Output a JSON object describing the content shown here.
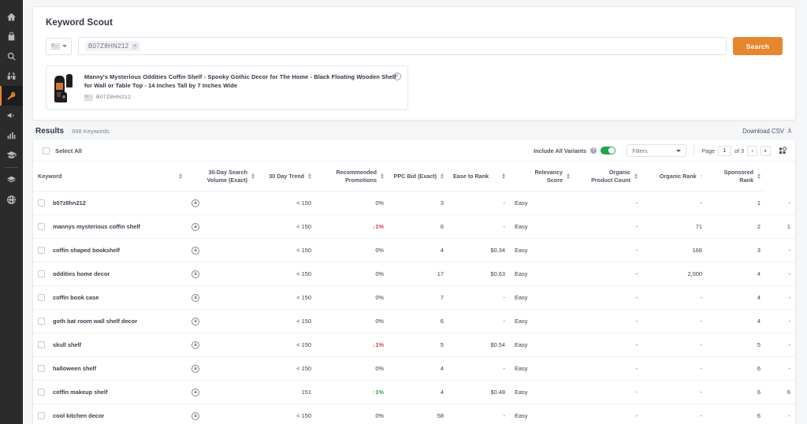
{
  "sidebar": {
    "items": [
      {
        "name": "home-icon",
        "label": "Home"
      },
      {
        "name": "product-database-icon",
        "label": "Product Database"
      },
      {
        "name": "search-icon",
        "label": "Opportunity Finder"
      },
      {
        "name": "binoculars-icon",
        "label": "Product Tracker"
      },
      {
        "name": "key-icon",
        "label": "Keyword Scout",
        "active": true
      },
      {
        "name": "megaphone-icon",
        "label": "Advertising"
      },
      {
        "name": "bar-chart-icon",
        "label": "Analytics"
      },
      {
        "name": "graduation-cap-icon",
        "label": "Academy"
      },
      {
        "name": "layers-icon",
        "label": "Tools"
      },
      {
        "name": "globe-icon",
        "label": "Global"
      }
    ]
  },
  "header": {
    "title": "Keyword Scout"
  },
  "search": {
    "country_flag": "us-flag-icon",
    "asin_chip": "B07Z8HN212",
    "chip_remove": "×",
    "search_button": "Search"
  },
  "product": {
    "title": "Manny's Mysterious Oddities Coffin Shelf - Spooky Gothic Decor for The Home - Black Floating Wooden Shelf for Wall or Table Top - 14 Inches Tall by 7 Inches Wide",
    "asin": "B07Z8HN212",
    "close": "×"
  },
  "results": {
    "label": "Results",
    "count": "698 Keywords",
    "download_csv": "Download CSV"
  },
  "toolbar": {
    "select_all": "Select All",
    "include_variants": "Include All Variants",
    "help": "?",
    "variants_on": true,
    "filters": "Filters",
    "page_label": "Page",
    "page_value": "1",
    "page_of": "of 3",
    "columns_icon": "columns-settings-icon"
  },
  "table": {
    "columns": [
      {
        "key": "keyword",
        "label": "Keyword",
        "align": "left",
        "sort": "arrows"
      },
      {
        "key": "volume",
        "label": "30-Day Search\nVolume (Exact)",
        "align": "right",
        "sort": "arrows"
      },
      {
        "key": "trend",
        "label": "30 Day Trend",
        "align": "right",
        "sort": "arrows"
      },
      {
        "key": "promos",
        "label": "Recommended\nPromotions",
        "align": "right",
        "sort": "arrows"
      },
      {
        "key": "ppc",
        "label": "PPC Bid (Exact)",
        "align": "right",
        "sort": "arrows"
      },
      {
        "key": "ease",
        "label": "Ease to Rank",
        "align": "left",
        "sort": "arrows"
      },
      {
        "key": "relevancy",
        "label": "Relevancy\nScore",
        "align": "right",
        "sort": "arrows"
      },
      {
        "key": "organic_count",
        "label": "Organic\nProduct Count",
        "align": "right",
        "sort": "arrows"
      },
      {
        "key": "organic_rank",
        "label": "Organic Rank",
        "align": "right",
        "sort": "dash"
      },
      {
        "key": "sponsored_rank",
        "label": "Sponsored\nRank",
        "align": "right",
        "sort": "arrows"
      }
    ],
    "rows": [
      {
        "keyword": "b07z8hn212",
        "source": "amazon-icon",
        "volume": "< 150",
        "trend": "0%",
        "trend_dir": "flat",
        "promos": "3",
        "ppc": "-",
        "ease": "Easy",
        "relevancy": "-",
        "organic_count": "-",
        "organic_rank": "1",
        "sponsored_rank": "-"
      },
      {
        "keyword": "mannys mysterious coffin shelf",
        "source": "amazon-icon",
        "volume": "< 150",
        "trend": "1%",
        "trend_dir": "down",
        "promos": "6",
        "ppc": "-",
        "ease": "Easy",
        "relevancy": "-",
        "organic_count": "71",
        "organic_rank": "2",
        "sponsored_rank": "1"
      },
      {
        "keyword": "coffin shaped bookshelf",
        "source": "amazon-icon",
        "volume": "< 150",
        "trend": "0%",
        "trend_dir": "flat",
        "promos": "4",
        "ppc": "$0.34",
        "ease": "Easy",
        "relevancy": "-",
        "organic_count": "168",
        "organic_rank": "3",
        "sponsored_rank": "-"
      },
      {
        "keyword": "oddities home decor",
        "source": "amazon-icon",
        "volume": "< 150",
        "trend": "0%",
        "trend_dir": "flat",
        "promos": "17",
        "ppc": "$0.63",
        "ease": "Easy",
        "relevancy": "-",
        "organic_count": "2,000",
        "organic_rank": "4",
        "sponsored_rank": "-"
      },
      {
        "keyword": "coffin book case",
        "source": "amazon-icon",
        "volume": "< 150",
        "trend": "0%",
        "trend_dir": "flat",
        "promos": "7",
        "ppc": "-",
        "ease": "Easy",
        "relevancy": "-",
        "organic_count": "-",
        "organic_rank": "4",
        "sponsored_rank": "-"
      },
      {
        "keyword": "goth bat room wall shelf decor",
        "source": "amazon-icon",
        "volume": "< 150",
        "trend": "0%",
        "trend_dir": "flat",
        "promos": "6",
        "ppc": "-",
        "ease": "Easy",
        "relevancy": "-",
        "organic_count": "-",
        "organic_rank": "4",
        "sponsored_rank": "-"
      },
      {
        "keyword": "skull shelf",
        "source": "amazon-icon",
        "volume": "< 150",
        "trend": "1%",
        "trend_dir": "down",
        "promos": "5",
        "ppc": "$0.54",
        "ease": "Easy",
        "relevancy": "-",
        "organic_count": "-",
        "organic_rank": "5",
        "sponsored_rank": "-"
      },
      {
        "keyword": "halloween shelf",
        "source": "amazon-icon",
        "volume": "< 150",
        "trend": "0%",
        "trend_dir": "flat",
        "promos": "4",
        "ppc": "-",
        "ease": "Easy",
        "relevancy": "-",
        "organic_count": "-",
        "organic_rank": "6",
        "sponsored_rank": "-"
      },
      {
        "keyword": "coffin makeup shelf",
        "source": "amazon-icon",
        "volume": "151",
        "trend": "1%",
        "trend_dir": "up",
        "promos": "4",
        "ppc": "$0.48",
        "ease": "Easy",
        "relevancy": "-",
        "organic_count": "-",
        "organic_rank": "6",
        "sponsored_rank": "6"
      },
      {
        "keyword": "cool kitchen decor",
        "source": "amazon-icon",
        "volume": "< 150",
        "trend": "0%",
        "trend_dir": "flat",
        "promos": "58",
        "ppc": "-",
        "ease": "Easy",
        "relevancy": "-",
        "organic_count": "-",
        "organic_rank": "6",
        "sponsored_rank": "-"
      }
    ]
  },
  "colors": {
    "accent_orange": "#e8862e",
    "toggle_green": "#22a24c",
    "trend_up": "#2e9e53",
    "trend_down": "#d23b4e",
    "sidebar_bg": "#2b2b2b"
  }
}
